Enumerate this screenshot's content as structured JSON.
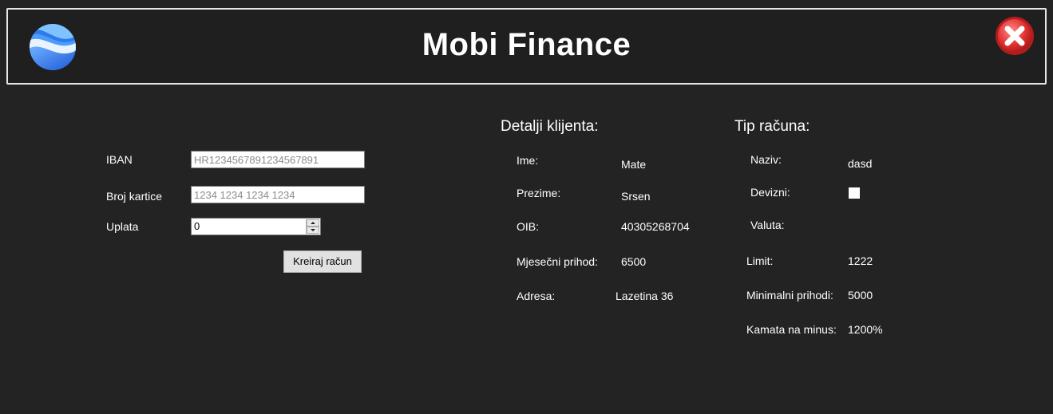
{
  "app": {
    "title": "Mobi Finance"
  },
  "colors": {
    "background": "#232323",
    "header_border": "#e6e6e6",
    "close_red": "#d32a2a",
    "logo_blue": "#2d7be8"
  },
  "icons": {
    "logo": "blue-wave-circle-icon",
    "close": "red-x-close-icon"
  },
  "form": {
    "iban_label": "IBAN",
    "iban_value": "HR1234567891234567891",
    "card_label": "Broj kartice",
    "card_value": "1234 1234 1234 1234",
    "payment_label": "Uplata",
    "payment_value": "0",
    "create_button": "Kreiraj račun"
  },
  "client": {
    "section_title": "Detalji klijenta:",
    "name_label": "Ime:",
    "name_value": "Mate",
    "surname_label": "Prezime:",
    "surname_value": "Srsen",
    "oib_label": "OIB:",
    "oib_value": "40305268704",
    "income_label": "Mjesečni prihod:",
    "income_value": "6500",
    "address_label": "Adresa:",
    "address_value": "Lazetina 36"
  },
  "account_type": {
    "section_title": "Tip računa:",
    "name_label": "Naziv:",
    "name_value": "dasd",
    "foreign_label": "Devizni:",
    "foreign_checked": false,
    "currency_label": "Valuta:",
    "currency_value": "",
    "limit_label": "Limit:",
    "limit_value": "1222",
    "min_income_label": "Minimalni prihodi:",
    "min_income_value": "5000",
    "interest_label": "Kamata na minus:",
    "interest_value": "1200%"
  }
}
